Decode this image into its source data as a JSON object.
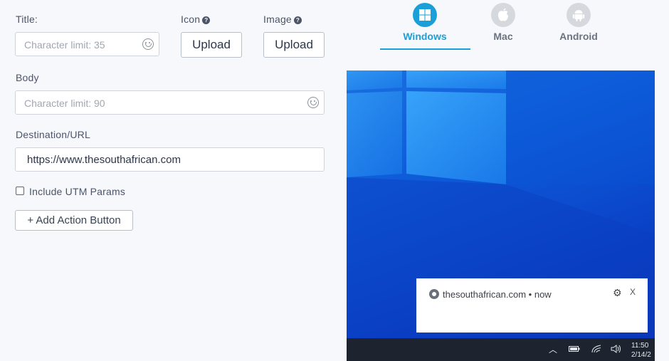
{
  "form": {
    "title_label": "Title:",
    "title_placeholder": "Character limit: 35",
    "icon_label": "Icon",
    "image_label": "Image",
    "icon_upload": "Upload",
    "image_upload": "Upload",
    "body_label": "Body",
    "body_placeholder": "Character limit: 90",
    "destination_label": "Destination/URL",
    "destination_value": "https://www.thesouthafrican.com",
    "utm_label": "Include UTM Params",
    "utm_checked": false,
    "add_action_label": "+ Add Action Button"
  },
  "platform_tabs": [
    {
      "label": "Windows",
      "icon": "windows-icon",
      "active": true,
      "color": "#1a9fd9"
    },
    {
      "label": "Mac",
      "icon": "apple-icon",
      "active": false,
      "color": "#6b7280"
    },
    {
      "label": "Android",
      "icon": "android-icon",
      "active": false,
      "color": "#6b7280"
    }
  ],
  "preview": {
    "notification_site": "thesouthafrican.com • now",
    "notification_close": "X",
    "clock_time": "11:50 ",
    "clock_date": "2/14/2"
  },
  "colors": {
    "accent": "#1a9fd9",
    "inactive_tab_circle": "#d5d8dd"
  }
}
